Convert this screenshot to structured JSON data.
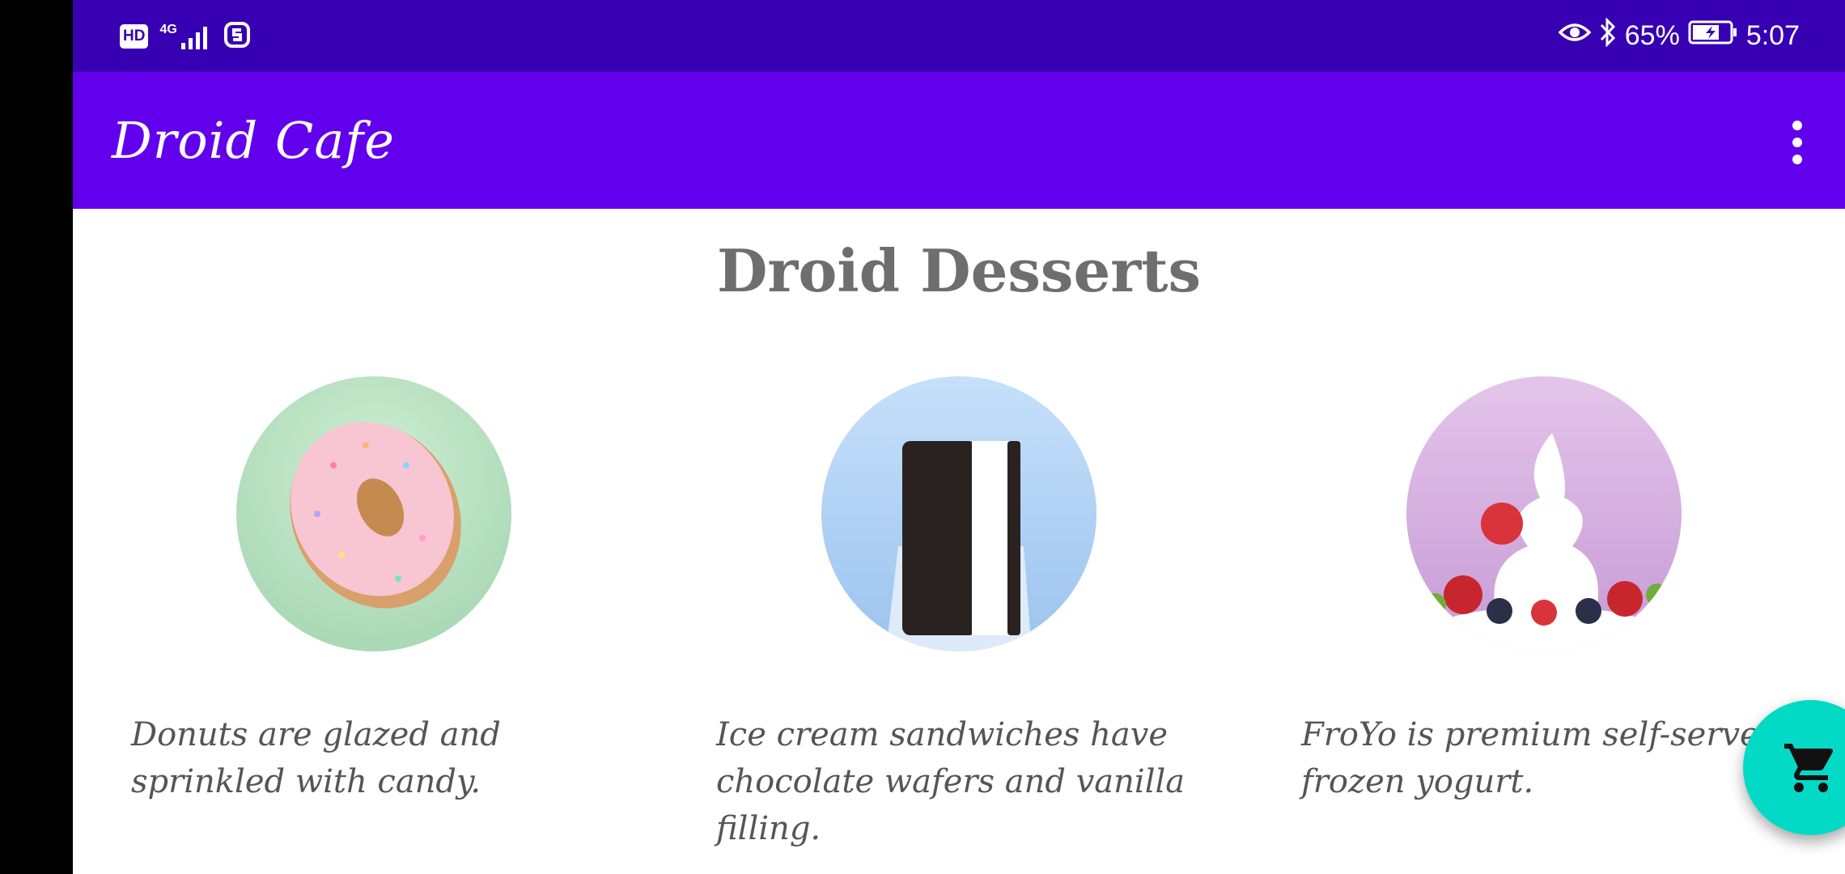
{
  "status_bar": {
    "left_icons": [
      "hd-icon",
      "signal-4g-icon",
      "sync-icon"
    ],
    "hd_label": "HD",
    "network_label": "4G",
    "battery_text": "65%",
    "time": "5:07",
    "right_icons": [
      "eye-icon",
      "bluetooth-icon",
      "battery-icon"
    ]
  },
  "app_bar": {
    "title": "Droid Cafe",
    "menu_icon": "overflow-menu-icon"
  },
  "main": {
    "heading": "Droid Desserts",
    "items": [
      {
        "name": "donut",
        "description": "Donuts are glazed and sprinkled with candy."
      },
      {
        "name": "ice-cream-sandwich",
        "description": "Ice cream sandwiches have chocolate wafers and vanilla filling."
      },
      {
        "name": "froyo",
        "description": "FroYo is premium self-serve frozen yogurt."
      }
    ]
  },
  "fab": {
    "icon": "shopping-cart-icon"
  },
  "colors": {
    "status_bar": "#3700b3",
    "app_bar": "#6200ee",
    "fab": "#03dac5",
    "heading_text": "#6e6e6e"
  }
}
